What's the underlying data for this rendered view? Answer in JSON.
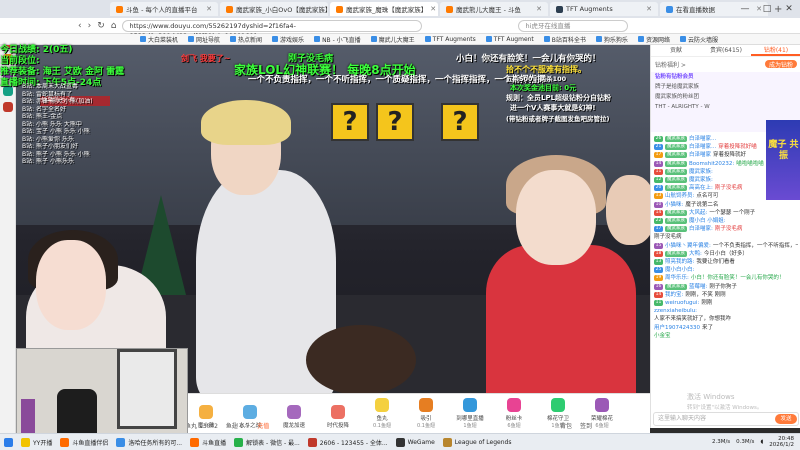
{
  "browser": {
    "tabs": [
      {
        "label": "斗鱼 - 每个人的直播平台",
        "active": false
      },
      {
        "label": "魔武家族_小白OvO【魔武家族】",
        "active": false
      },
      {
        "label": "魔武家族_魔珠【魔武家族】",
        "active": true
      },
      {
        "label": "魔武熊儿大魔王 - 斗鱼",
        "active": false
      },
      {
        "label": "TFT Augments",
        "active": false
      },
      {
        "label": "在看直播数据",
        "active": false
      }
    ],
    "url": "https://www.douyu.com/55262197dyshid=2f16fa4-8532d0a399dd82adf6f31b4e00001601",
    "search_placeholder": "hi虎牙在线直播",
    "bookmarks": [
      "大白菜装机",
      "网址导航",
      "热点新闻",
      "游戏娱乐",
      "NB - 小飞直播",
      "魔武儿大魔王",
      "TFT Augments",
      "TFT Augment",
      "B站百科全书",
      "狗乐狗乐",
      "资源网络",
      "云防火墙服"
    ],
    "window_controls": [
      "—",
      "□",
      "✕"
    ]
  },
  "stream_overlay": {
    "stats": [
      "今日战绩: 2(0五)",
      "当前段位:",
      "推荐装备: 海王 艾欧 金阿 雷霆",
      "直播时间: 下午5点-24点"
    ],
    "ticker_top": "弹幕奖池: 有",
    "left_ticker": [
      "B站: 本周末大战蓝毒",
      "B站: 雷蛇鼠标有了",
      "B站: 赤锋 熊大 小熊(加油)",
      "B站: 名字全名好",
      "B站: 熊王-金点",
      "B站: 小熊 乐乐 大熊中",
      "B站: 宝子 小熊 乐乐 小熊",
      "B站: 小熊爱你 乐乐",
      "B站: 熊子小朋友们好",
      "B站: 熊子 小熊 乐乐 小熊",
      "B站: 熊子 小熊乐乐"
    ],
    "red_label": "剑飞 我要了~",
    "title_green": "家族LOL幻神联赛！ 每晚8点开始",
    "title_white_1": "一个不负责指挥，一个不听指挥，一个质疑指挥，一个指挥指挥，一个指挥指挥",
    "name_top": "刚子没毛病",
    "right_white_1": "小白！你还有脸笑！一会儿有你哭的！",
    "right_yellow": "拾不个不服难有指挥。",
    "right_green": "本次奖金池目前: 0元",
    "right_rule_1": "规则：全员LPL超级钻粉分自钻粉",
    "right_rule_2": "进一个V人赛事大就是幻神!",
    "right_rule_3": "(带钻粉或者牌子截图发鱼吧房管拉)",
    "right_small": "五杀500 · 两杀100"
  },
  "video_toolbar": {
    "items": [
      {
        "label": "魔小雅",
        "sub": ""
      },
      {
        "label": "水斗之战",
        "sub": ""
      },
      {
        "label": "魔龙加速",
        "sub": ""
      },
      {
        "label": "时代投降",
        "sub": ""
      },
      {
        "label": "鱼丸",
        "sub": "0.1鱼翅"
      },
      {
        "label": "吸引",
        "sub": "0.1鱼翅"
      },
      {
        "label": "到哪里直播",
        "sub": "1鱼翅"
      },
      {
        "label": "粉丝卡",
        "sub": "6鱼翅"
      },
      {
        "label": "棉花守卫",
        "sub": "1鱼翅"
      },
      {
        "label": "荣耀棉花",
        "sub": "6鱼翅"
      }
    ],
    "fish_balls": "鱼丸 13042",
    "fish_fins": "鱼翅 0.7",
    "recharge": "充值",
    "backpack": "背包",
    "sign": "签到"
  },
  "panel": {
    "tabs": [
      {
        "label": "贡献",
        "active": false
      },
      {
        "label": "贵宾(6415)",
        "active": false
      },
      {
        "label": "钻粉(41)",
        "active": true
      }
    ],
    "sub_left": "钻粉福利 >",
    "sub_right": "成为钻粉",
    "fans_title": "钻粉有钻粉会员",
    "fan_rows": [
      "牌子是给魔武家族",
      "魔武家族的粉丝团",
      "THT - ALRIGHTY - W"
    ],
    "promo_text": "魔子 共振",
    "chat": [
      {
        "lvl": "26",
        "badge": "魔武家族",
        "user": "白泽喵家...",
        "text": ""
      },
      {
        "lvl": "21",
        "badge": "魔武家族",
        "user": "白泽喵家...",
        "text": "穿着投降就好喵"
      },
      {
        "lvl": "17",
        "badge": "魔武家族",
        "user": "白泽喵家",
        "text": "穿着投降就好"
      },
      {
        "lvl": "14",
        "badge": "魔武家族",
        "user": "Boomshit20232:",
        "text": "喵啦喵啦喵"
      },
      {
        "lvl": "11",
        "badge": "魔武家族",
        "user": "魔武家族:",
        "text": ""
      },
      {
        "lvl": "12",
        "badge": "魔武家族",
        "user": "魔武家族:",
        "text": ""
      },
      {
        "lvl": "20",
        "badge": "魔武家族",
        "user": "高高在上:",
        "text": "刚子没毛病"
      },
      {
        "lvl": "13",
        "badge": "",
        "user": "山航饲养员:",
        "text": "点名可可"
      },
      {
        "lvl": "10",
        "badge": "",
        "user": "小猫咪:",
        "text": "魔子说第二名"
      },
      {
        "lvl": "14",
        "badge": "魔武家族",
        "user": "大风起:",
        "text": "一个瑟瑟 一个刚子"
      },
      {
        "lvl": "22",
        "badge": "魔武家族",
        "user": "魔小白 小娟姐:",
        "text": ""
      },
      {
        "lvl": "17",
        "badge": "魔武家族",
        "user": "白泽喵家:",
        "text": "刚子没毛病"
      },
      {
        "lvl": "",
        "badge": "",
        "user": "",
        "text": "刚子没毛病"
      },
      {
        "lvl": "15",
        "badge": "",
        "user": "小猫咪丶翼年偏爱:",
        "text": "一个不负责指挥，一个不听指挥，一个质疑指挥，一个指挥指挥，还有一个指挥指挥"
      },
      {
        "lvl": "18",
        "badge": "魔武家族",
        "user": "大鸭:",
        "text": "今日小白（好多）"
      },
      {
        "lvl": "13",
        "badge": "",
        "user": "照亮我的路:",
        "text": "我要让你们看看"
      },
      {
        "lvl": "25",
        "badge": "",
        "user": "魔小白小白:",
        "text": ""
      },
      {
        "lvl": "19",
        "badge": "",
        "user": "周华乐乐:",
        "text": "小白！你还有脸笑！一会儿有你哭的！"
      },
      {
        "lvl": "16",
        "badge": "魔武家族",
        "user": "蓝莓喵:",
        "text": "刚子你狗子"
      },
      {
        "lvl": "14",
        "badge": "",
        "user": "我的宝:",
        "text": "刚刚，不笑 刚刚"
      },
      {
        "lvl": "11",
        "badge": "",
        "user": "weiruofugui:",
        "text": "刚刚"
      },
      {
        "lvl": "",
        "badge": "",
        "user": "zzenxiaheibulu:",
        "text": ""
      },
      {
        "lvl": "",
        "badge": "",
        "user": "",
        "text": "人家不来搞笑就好了，你想我咋"
      },
      {
        "lvl": "",
        "badge": "",
        "user": "用户1907424330",
        "text": "来了"
      },
      {
        "lvl": "",
        "badge": "",
        "user": "",
        "text": "小金宝"
      }
    ],
    "input_placeholder": "这里输入聊天内容",
    "send_label": "发送",
    "watermark": "激活 Windows",
    "watermark_sub": "转到\"设置\"以激活 Windows。"
  },
  "taskbar": {
    "items": [
      {
        "label": "YY开播",
        "color": "#f2c300"
      },
      {
        "label": "斗鱼直播伴侣",
        "color": "#ff6a00"
      },
      {
        "label": "洛哈任务所有的可...",
        "color": "#3a8ee6"
      },
      {
        "label": "斗鱼直播",
        "color": "#ff6a00"
      },
      {
        "label": "解锁表 - 微信 - 最...",
        "color": "#27b14a"
      },
      {
        "label": "2606 - 123455 - 全体...",
        "color": "#c0392b"
      },
      {
        "label": "WeGame",
        "color": "#333333"
      },
      {
        "label": "League of Legends",
        "color": "#b8862e"
      }
    ],
    "net_up": "2.3M/s",
    "net_down": "0.3M/s",
    "time": "20:48",
    "date": "2026/1/2"
  },
  "colors": {
    "accent": "#ff5d23",
    "overlay_green": "#3cff3c"
  }
}
